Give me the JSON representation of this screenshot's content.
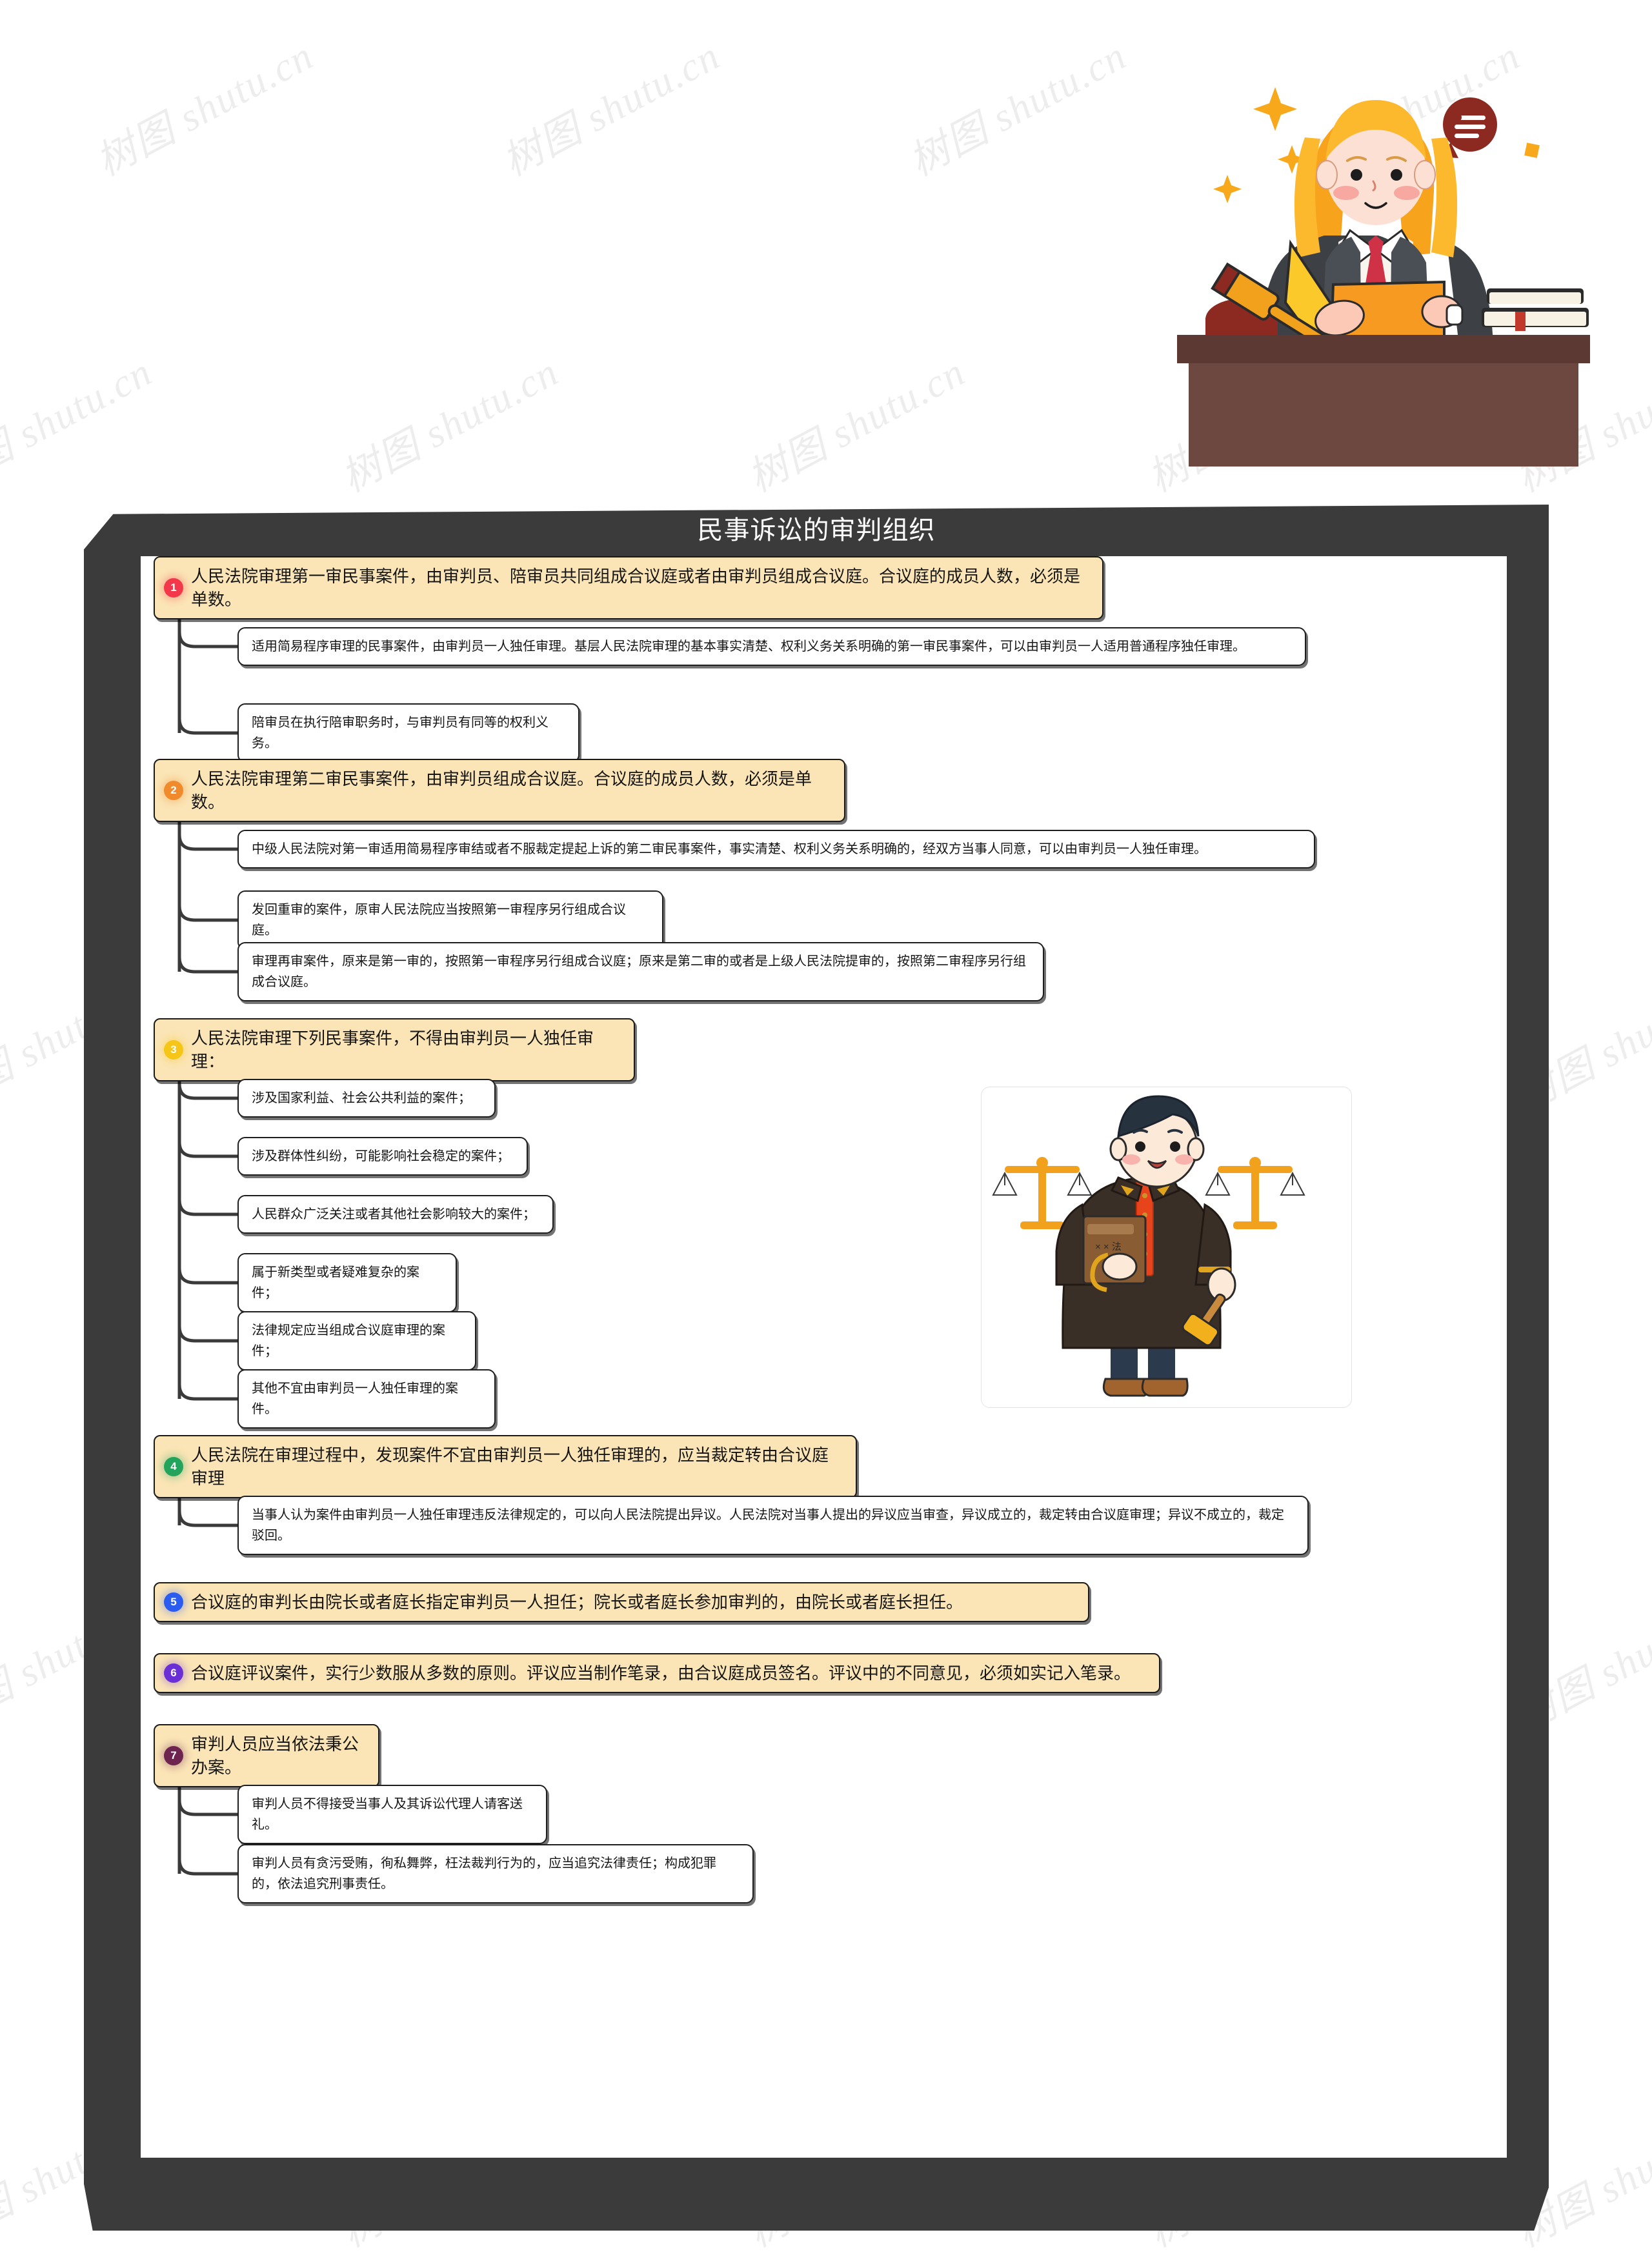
{
  "page": {
    "title": "民事诉讼的审判组织",
    "watermark_text": "树图 shutu.cn",
    "colors": {
      "frame": "#3b3b3b",
      "level1_bg": "#fbe5b6",
      "level1_border": "#1a1a1a",
      "level2_bg": "#ffffff",
      "level2_border": "#1e1e1e"
    }
  },
  "badges": [
    {
      "num": "1",
      "color": "#f2384a"
    },
    {
      "num": "2",
      "color": "#f08a2a"
    },
    {
      "num": "3",
      "color": "#f5c518"
    },
    {
      "num": "4",
      "color": "#22a45d"
    },
    {
      "num": "5",
      "color": "#2b5cf0"
    },
    {
      "num": "6",
      "color": "#6b2fd6"
    },
    {
      "num": "7",
      "color": "#6d2550"
    }
  ],
  "sections": [
    {
      "num": "1",
      "title": "人民法院审理第一审民事案件，由审判员、陪审员共同组成合议庭或者由审判员组成合议庭。合议庭的成员人数，必须是单数。",
      "children": [
        "适用简易程序审理的民事案件，由审判员一人独任审理。基层人民法院审理的基本事实清楚、权利义务关系明确的第一审民事案件，可以由审判员一人适用普通程序独任审理。",
        "陪审员在执行陪审职务时，与审判员有同等的权利义务。"
      ]
    },
    {
      "num": "2",
      "title": "人民法院审理第二审民事案件，由审判员组成合议庭。合议庭的成员人数，必须是单数。",
      "children": [
        "中级人民法院对第一审适用简易程序审结或者不服裁定提起上诉的第二审民事案件，事实清楚、权利义务关系明确的，经双方当事人同意，可以由审判员一人独任审理。",
        "发回重审的案件，原审人民法院应当按照第一审程序另行组成合议庭。",
        "审理再审案件，原来是第一审的，按照第一审程序另行组成合议庭；原来是第二审的或者是上级人民法院提审的，按照第二审程序另行组成合议庭。"
      ]
    },
    {
      "num": "3",
      "title": "人民法院审理下列民事案件，不得由审判员一人独任审理：",
      "children": [
        "涉及国家利益、社会公共利益的案件；",
        "涉及群体性纠纷，可能影响社会稳定的案件；",
        "人民群众广泛关注或者其他社会影响较大的案件；",
        "属于新类型或者疑难复杂的案件；",
        "法律规定应当组成合议庭审理的案件；",
        "其他不宜由审判员一人独任审理的案件。"
      ]
    },
    {
      "num": "4",
      "title": "人民法院在审理过程中，发现案件不宜由审判员一人独任审理的，应当裁定转由合议庭审理",
      "children": [
        "当事人认为案件由审判员一人独任审理违反法律规定的，可以向人民法院提出异议。人民法院对当事人提出的异议应当审查，异议成立的，裁定转由合议庭审理；异议不成立的，裁定驳回。"
      ]
    },
    {
      "num": "5",
      "title": "合议庭的审判长由院长或者庭长指定审判员一人担任；院长或者庭长参加审判的，由院长或者庭长担任。",
      "children": []
    },
    {
      "num": "6",
      "title": "合议庭评议案件，实行少数服从多数的原则。评议应当制作笔录，由合议庭成员签名。评议中的不同意见，必须如实记入笔录。",
      "children": []
    },
    {
      "num": "7",
      "title": "审判人员应当依法秉公办案。",
      "children": [
        "审判人员不得接受当事人及其诉讼代理人请客送礼。",
        "审判人员有贪污受贿，徇私舞弊，枉法裁判行为的，应当追究法律责任；构成犯罪的，依法追究刑事责任。"
      ]
    }
  ],
  "illustrations": {
    "hero": {
      "name": "female-judge-at-bench-illustration",
      "elements": [
        "judge",
        "gavel",
        "books",
        "bench",
        "speech-bubble",
        "sparkles"
      ]
    },
    "card": {
      "name": "male-judge-with-scales-illustration",
      "elements": [
        "judge",
        "law-book",
        "gavel",
        "scales-of-justice"
      ]
    }
  }
}
